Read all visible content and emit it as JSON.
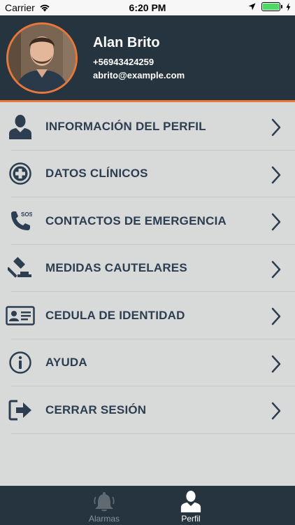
{
  "status_bar": {
    "carrier": "Carrier",
    "time": "6:20 PM",
    "battery_level": 1.0
  },
  "profile": {
    "name": "Alan Brito",
    "phone": "+56943424259",
    "email": "abrito@example.com"
  },
  "menu": {
    "items": [
      {
        "label": "INFORMACIÓN DEL PERFIL",
        "icon": "user-icon"
      },
      {
        "label": "DATOS CLÍNICOS",
        "icon": "medical-cross-icon"
      },
      {
        "label": "CONTACTOS DE EMERGENCIA",
        "icon": "sos-phone-icon",
        "icon_text": "SOS"
      },
      {
        "label": "MEDIDAS CAUTELARES",
        "icon": "gavel-icon"
      },
      {
        "label": "CEDULA DE IDENTIDAD",
        "icon": "id-card-icon"
      },
      {
        "label": "AYUDA",
        "icon": "info-icon"
      },
      {
        "label": "CERRAR SESIÓN",
        "icon": "logout-icon"
      }
    ]
  },
  "tab_bar": {
    "tabs": [
      {
        "label": "Alarmas",
        "icon": "bell-icon",
        "active": false
      },
      {
        "label": "Perfil",
        "icon": "user-icon",
        "active": true
      }
    ]
  },
  "colors": {
    "header_bg": "#25343f",
    "accent": "#e8783a",
    "menu_bg": "#d8d9d9",
    "text_dark": "#2c3e50"
  }
}
